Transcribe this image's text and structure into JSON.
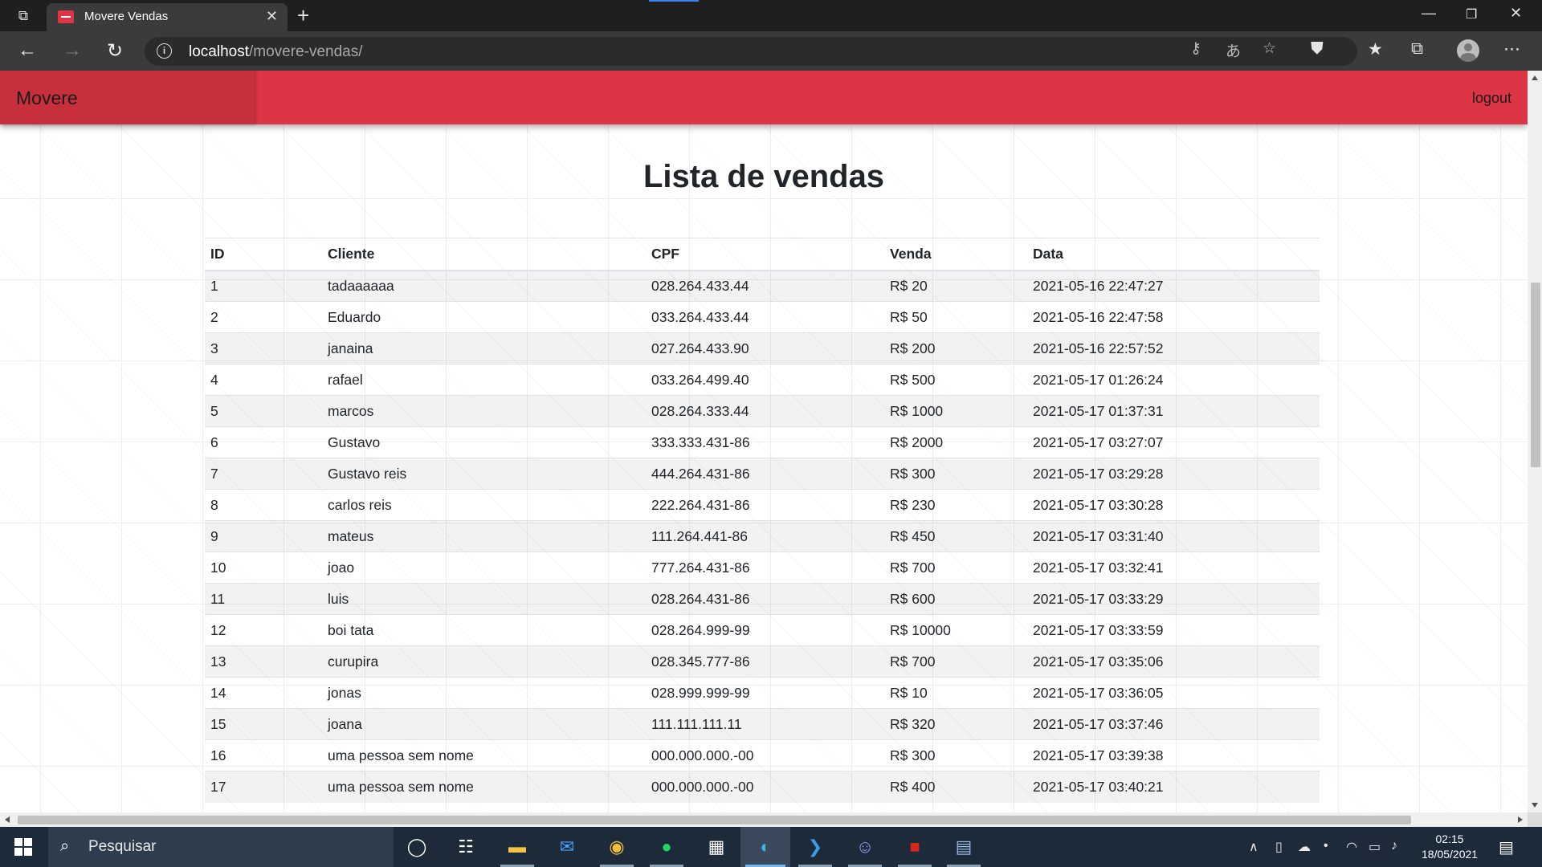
{
  "browser": {
    "tab_title": "Movere Vendas",
    "url_host": "localhost",
    "url_path": "/movere-vendas/"
  },
  "app": {
    "brand": "Movere",
    "logout": "logout",
    "brand_color": "#dc3545"
  },
  "page": {
    "title": "Lista de vendas"
  },
  "table": {
    "headers": [
      "ID",
      "Cliente",
      "CPF",
      "Venda",
      "Data"
    ],
    "rows": [
      [
        "1",
        "tadaaaaaa",
        "028.264.433.44",
        "R$ 20",
        "2021-05-16 22:47:27"
      ],
      [
        "2",
        "Eduardo",
        "033.264.433.44",
        "R$ 50",
        "2021-05-16 22:47:58"
      ],
      [
        "3",
        "janaina",
        "027.264.433.90",
        "R$ 200",
        "2021-05-16 22:57:52"
      ],
      [
        "4",
        "rafael",
        "033.264.499.40",
        "R$ 500",
        "2021-05-17 01:26:24"
      ],
      [
        "5",
        "marcos",
        "028.264.333.44",
        "R$ 1000",
        "2021-05-17 01:37:31"
      ],
      [
        "6",
        "Gustavo",
        "333.333.431-86",
        "R$ 2000",
        "2021-05-17 03:27:07"
      ],
      [
        "7",
        "Gustavo reis",
        "444.264.431-86",
        "R$ 300",
        "2021-05-17 03:29:28"
      ],
      [
        "8",
        "carlos reis",
        "222.264.431-86",
        "R$ 230",
        "2021-05-17 03:30:28"
      ],
      [
        "9",
        "mateus",
        "111.264.441-86",
        "R$ 450",
        "2021-05-17 03:31:40"
      ],
      [
        "10",
        "joao",
        "777.264.431-86",
        "R$ 700",
        "2021-05-17 03:32:41"
      ],
      [
        "11",
        "luis",
        "028.264.431-86",
        "R$ 600",
        "2021-05-17 03:33:29"
      ],
      [
        "12",
        "boi tata",
        "028.264.999-99",
        "R$ 10000",
        "2021-05-17 03:33:59"
      ],
      [
        "13",
        "curupira",
        "028.345.777-86",
        "R$ 700",
        "2021-05-17 03:35:06"
      ],
      [
        "14",
        "jonas",
        "028.999.999-99",
        "R$ 10",
        "2021-05-17 03:36:05"
      ],
      [
        "15",
        "joana",
        "111.111.111.11",
        "R$ 320",
        "2021-05-17 03:37:46"
      ],
      [
        "16",
        "uma pessoa sem nome",
        "000.000.000.-00",
        "R$ 300",
        "2021-05-17 03:39:38"
      ],
      [
        "17",
        "uma pessoa sem nome",
        "000.000.000.-00",
        "R$ 400",
        "2021-05-17 03:40:21"
      ]
    ]
  },
  "taskbar": {
    "search_placeholder": "Pesquisar",
    "time": "02:15",
    "date": "18/05/2021",
    "apps": [
      "cortana-icon",
      "task-view-icon",
      "file-explorer-icon",
      "mail-icon",
      "chrome-icon",
      "spotify-icon",
      "store-icon",
      "edge-icon",
      "vscode-icon",
      "discord-icon",
      "filezilla-icon",
      "notepad-icon"
    ]
  }
}
